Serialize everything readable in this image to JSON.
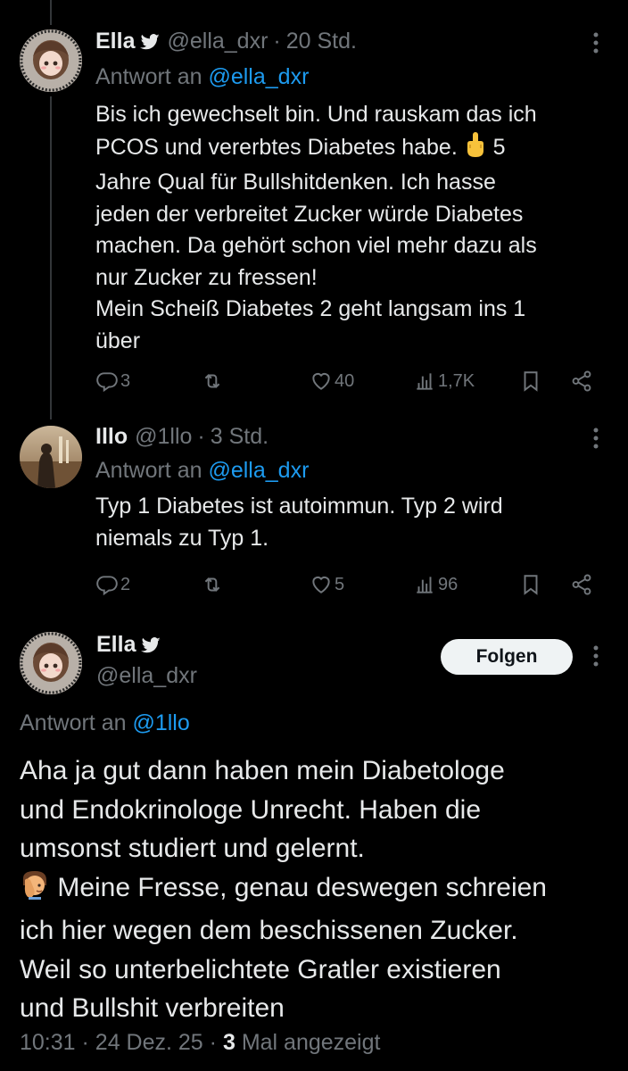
{
  "tweets": [
    {
      "name": "Ella",
      "handle": "@ella_dxr",
      "sep": "·",
      "time": "20 Std.",
      "reply_prefix": "Antwort an",
      "reply_handle": "@ella_dxr",
      "text_before_emoji": "Bis ich gewechselt bin. Und rauskam das ich\nPCOS und vererbtes Diabetes habe. ",
      "emoji": "middle-finger-emoji",
      "text_after_emoji": " 5\nJahre Qual für Bullshitdenken. Ich hasse\njeden der verbreitet Zucker würde Diabetes\nmachen. Da gehört schon viel mehr dazu als\nnur Zucker zu fressen!\nMein Scheiß Diabetes 2 geht langsam ins 1\nüber",
      "replies": "3",
      "retweets": "",
      "likes": "40",
      "views": "1,7K"
    },
    {
      "name": "Illo",
      "handle": "@1llo",
      "sep": "·",
      "time": "3 Std.",
      "reply_prefix": "Antwort an",
      "reply_handle": "@ella_dxr",
      "text": "Typ 1 Diabetes ist autoimmun. Typ 2 wird\nniemals zu Typ 1.",
      "replies": "2",
      "retweets": "",
      "likes": "5",
      "views": "96"
    }
  ],
  "main_tweet": {
    "name": "Ella",
    "handle": "@ella_dxr",
    "follow_label": "Folgen",
    "reply_prefix": "Antwort an",
    "reply_handle": "@1llo",
    "text_part1": "Aha ja gut dann haben mein Diabetologe\nund Endokrinologe Unrecht. Haben die\numsonst studiert und gelernt.\n",
    "emoji": "facepalm-emoji",
    "text_part2": " Meine Fresse, genau deswegen schreien\nich hier wegen dem beschissenen Zucker.\nWeil so unterbelichtete Gratler existieren\nund Bullshit verbreiten",
    "time": "10:31",
    "date": "24 Dez. 25",
    "views": "3",
    "views_label": "Mal angezeigt",
    "sep": "·"
  },
  "colors": {
    "background": "#000000",
    "text": "#e7e9ea",
    "muted": "#71767b",
    "link": "#1d9bf0",
    "follow_bg": "#eff3f4"
  }
}
